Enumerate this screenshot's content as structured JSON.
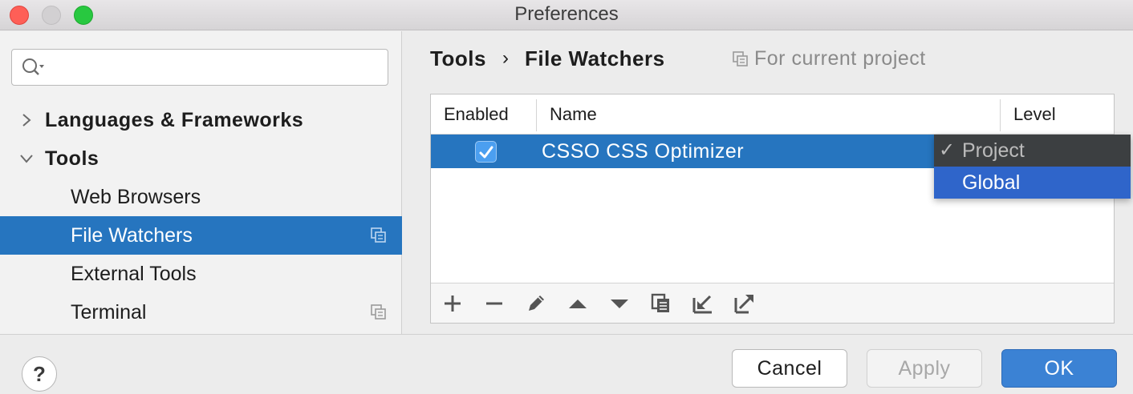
{
  "window": {
    "title": "Preferences"
  },
  "sidebar": {
    "search": {
      "placeholder": ""
    },
    "items": [
      {
        "label": "Languages & Frameworks",
        "level": 0,
        "expanded": false
      },
      {
        "label": "Tools",
        "level": 0,
        "expanded": true
      },
      {
        "label": "Web Browsers",
        "level": 1
      },
      {
        "label": "File Watchers",
        "level": 1,
        "selected": true,
        "project_scoped": true
      },
      {
        "label": "External Tools",
        "level": 1
      },
      {
        "label": "Terminal",
        "level": 1,
        "project_scoped": true
      }
    ]
  },
  "main": {
    "breadcrumb": {
      "parent": "Tools",
      "separator": "›",
      "current": "File Watchers"
    },
    "scope_label": "For current project",
    "table": {
      "columns": [
        "Enabled",
        "Name",
        "Level"
      ],
      "rows": [
        {
          "enabled": true,
          "name": "CSSO CSS Optimizer",
          "level": "Project"
        }
      ]
    },
    "toolbar": [
      "add-icon",
      "remove-icon",
      "edit-icon",
      "move-up-icon",
      "move-down-icon",
      "copy-icon",
      "import-icon",
      "export-icon"
    ]
  },
  "level_dropdown": {
    "options": [
      {
        "label": "Project",
        "checked": true
      },
      {
        "label": "Global",
        "highlighted": true
      }
    ]
  },
  "footer": {
    "help_label": "?",
    "cancel_label": "Cancel",
    "apply_label": "Apply",
    "ok_label": "OK"
  },
  "colors": {
    "selection": "#2675bf",
    "popup_bg": "#3c3f41",
    "popup_highlight": "#2f65ca",
    "ok_button": "#3b82d4"
  }
}
